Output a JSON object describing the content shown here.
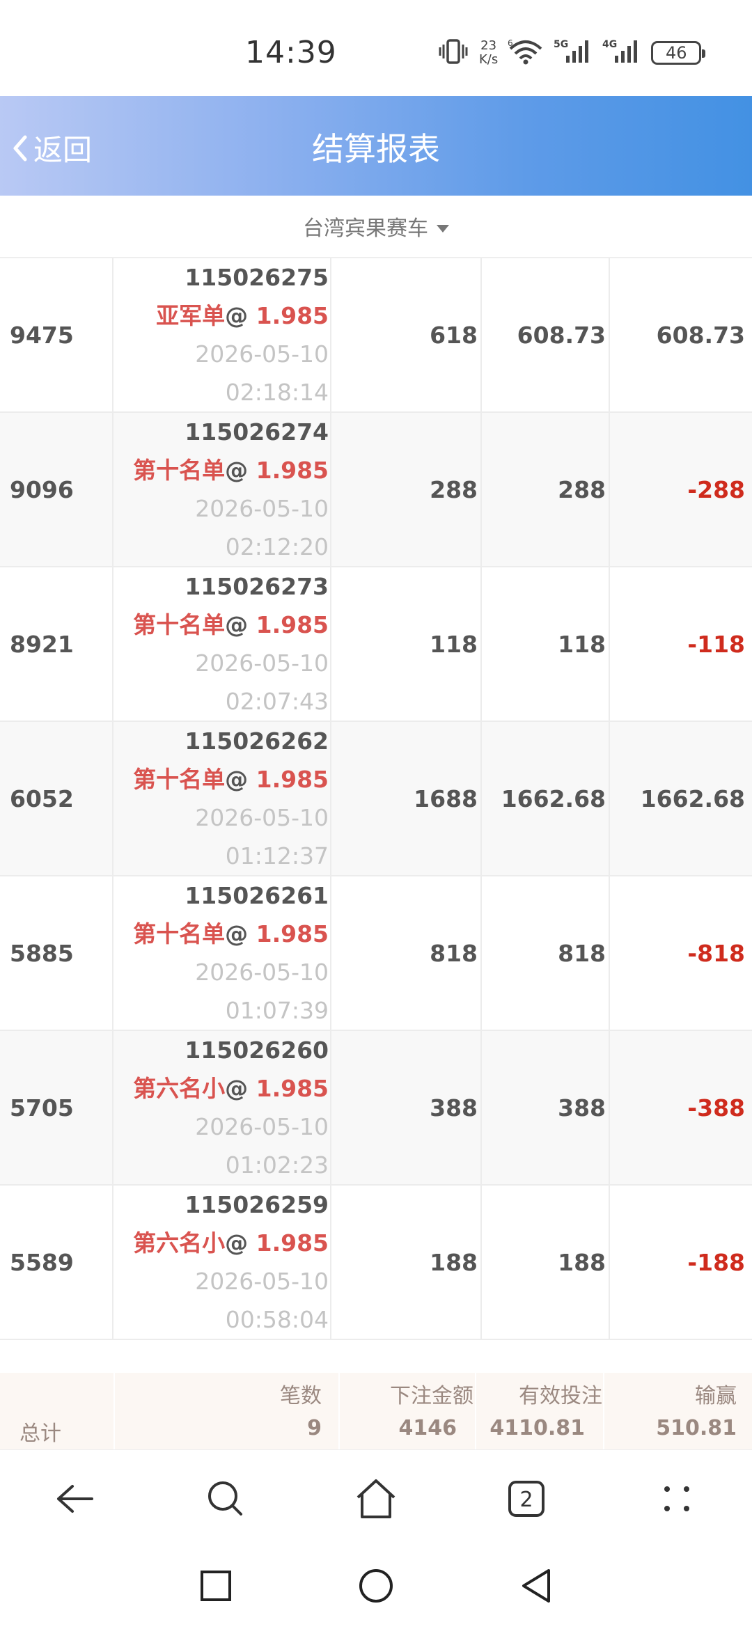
{
  "status_bar": {
    "time": "14:39",
    "net_speed_value": "23",
    "net_speed_unit": "K/s",
    "wifi_label": "6",
    "sim1_label": "5G",
    "sim2_label": "4G",
    "battery": "46"
  },
  "header": {
    "back_label": "返回",
    "title": "结算报表"
  },
  "selector": {
    "game": "台湾宾果赛车"
  },
  "rows": [
    {
      "period": "9475",
      "order_id": "115026275",
      "bet": "亚军单",
      "at": "@",
      "odds": "1.985",
      "date": "2026-05-10",
      "time": "02:18:14",
      "amount": "618",
      "valid": "608.73",
      "win": "608.73",
      "win_negative": false
    },
    {
      "period": "9096",
      "order_id": "115026274",
      "bet": "第十名单",
      "at": "@",
      "odds": "1.985",
      "date": "2026-05-10",
      "time": "02:12:20",
      "amount": "288",
      "valid": "288",
      "win": "-288",
      "win_negative": true
    },
    {
      "period": "8921",
      "order_id": "115026273",
      "bet": "第十名单",
      "at": "@",
      "odds": "1.985",
      "date": "2026-05-10",
      "time": "02:07:43",
      "amount": "118",
      "valid": "118",
      "win": "-118",
      "win_negative": true
    },
    {
      "period": "6052",
      "order_id": "115026262",
      "bet": "第十名单",
      "at": "@",
      "odds": "1.985",
      "date": "2026-05-10",
      "time": "01:12:37",
      "amount": "1688",
      "valid": "1662.68",
      "win": "1662.68",
      "win_negative": false
    },
    {
      "period": "5885",
      "order_id": "115026261",
      "bet": "第十名单",
      "at": "@",
      "odds": "1.985",
      "date": "2026-05-10",
      "time": "01:07:39",
      "amount": "818",
      "valid": "818",
      "win": "-818",
      "win_negative": true
    },
    {
      "period": "5705",
      "order_id": "115026260",
      "bet": "第六名小",
      "at": "@",
      "odds": "1.985",
      "date": "2026-05-10",
      "time": "01:02:23",
      "amount": "388",
      "valid": "388",
      "win": "-388",
      "win_negative": true
    },
    {
      "period": "5589",
      "order_id": "115026259",
      "bet": "第六名小",
      "at": "@",
      "odds": "1.985",
      "date": "2026-05-10",
      "time": "00:58:04",
      "amount": "188",
      "valid": "188",
      "win": "-188",
      "win_negative": true
    }
  ],
  "totals": {
    "label": "总计",
    "headers": {
      "count": "笔数",
      "amount": "下注金额",
      "valid": "有效投注",
      "win": "输赢"
    },
    "values": {
      "count": "9",
      "amount": "4146",
      "valid": "4110.81",
      "win": "510.81"
    }
  },
  "toolbar": {
    "tab_count": "2",
    "icons": [
      "back-arrow-icon",
      "search-icon",
      "home-icon",
      "tabs-icon",
      "more-icon"
    ]
  },
  "navbar": {
    "icons": [
      "recents-square-icon",
      "home-circle-icon",
      "back-triangle-icon"
    ]
  },
  "colors": {
    "header_start": "#b9c9f4",
    "header_end": "#4391e3",
    "bet_red": "#d9534f",
    "negative_red": "#cf2b1d",
    "totals_bg": "#fcf7f3"
  }
}
